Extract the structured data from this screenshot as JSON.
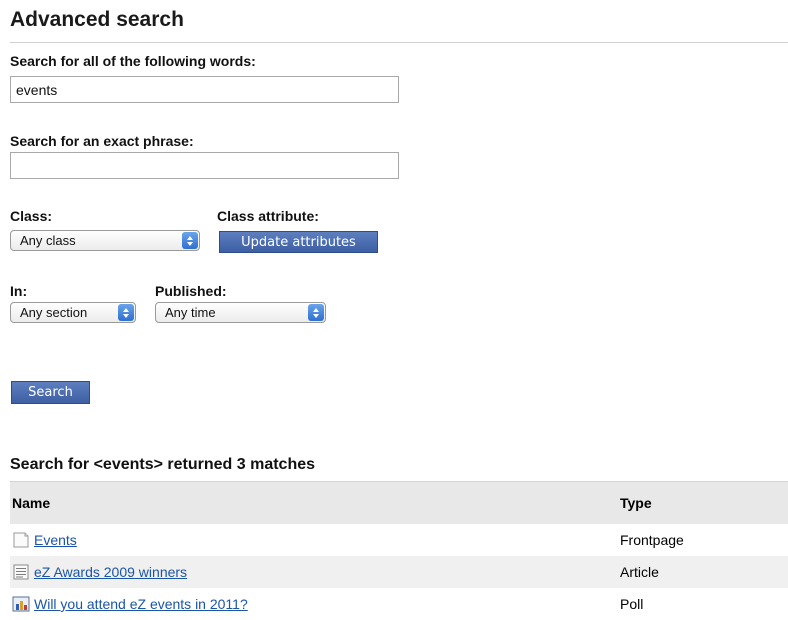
{
  "page": {
    "title": "Advanced search"
  },
  "form": {
    "all_words": {
      "label": "Search for all of the following words:",
      "value": "events"
    },
    "exact_phrase": {
      "label": "Search for an exact phrase:",
      "value": ""
    },
    "class": {
      "label": "Class:",
      "selected": "Any class"
    },
    "class_attribute": {
      "label": "Class attribute:",
      "button": "Update attributes"
    },
    "in": {
      "label": "In:",
      "selected": "Any section"
    },
    "published": {
      "label": "Published:",
      "selected": "Any time"
    },
    "search_button": "Search"
  },
  "results": {
    "heading": "Search for <events> returned 3 matches",
    "columns": [
      "Name",
      "Type"
    ],
    "rows": [
      {
        "name": "Events",
        "type": "Frontpage",
        "icon": "frontpage-icon"
      },
      {
        "name": "eZ Awards 2009 winners",
        "type": "Article",
        "icon": "article-icon"
      },
      {
        "name": "Will you attend eZ events in 2011?",
        "type": "Poll",
        "icon": "poll-icon"
      }
    ]
  },
  "colors": {
    "button": "#4a6cb0",
    "link": "#1a55a8",
    "header_bg": "#e8e8e8",
    "row_alt_bg": "#f0f0f0"
  }
}
